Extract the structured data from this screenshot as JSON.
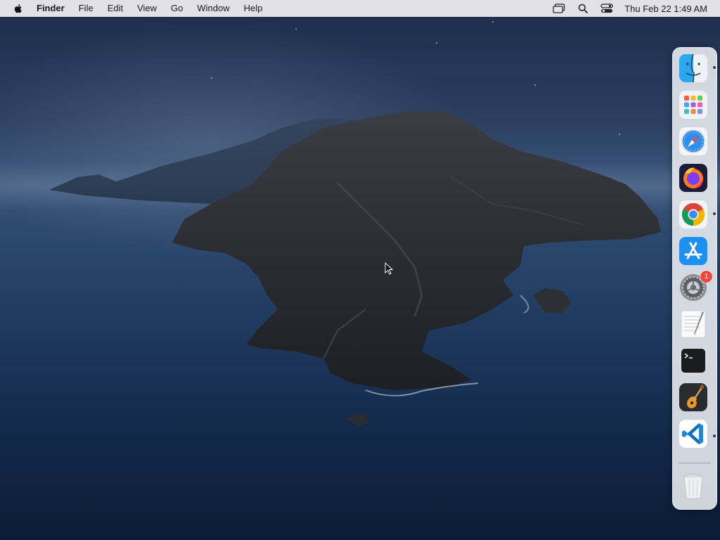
{
  "menubar": {
    "app_name": "Finder",
    "menus": [
      "File",
      "Edit",
      "View",
      "Go",
      "Window",
      "Help"
    ],
    "clock": "Thu Feb 22  1:49 AM",
    "status_icons": [
      "screen-mirroring-icon",
      "spotlight-search-icon",
      "control-center-icon"
    ]
  },
  "dock": {
    "items": [
      {
        "name": "Finder",
        "icon": "finder-icon",
        "running": true
      },
      {
        "name": "Launchpad",
        "icon": "launchpad-icon",
        "running": false
      },
      {
        "name": "Safari",
        "icon": "safari-icon",
        "running": false
      },
      {
        "name": "Firefox",
        "icon": "firefox-icon",
        "running": false
      },
      {
        "name": "Google Chrome",
        "icon": "chrome-icon",
        "running": true
      },
      {
        "name": "App Store",
        "icon": "app-store-icon",
        "running": false
      },
      {
        "name": "System Preferences",
        "icon": "system-preferences-icon",
        "running": false,
        "badge": "1"
      },
      {
        "name": "TextEdit",
        "icon": "textedit-icon",
        "running": false
      },
      {
        "name": "Terminal",
        "icon": "terminal-icon",
        "running": false
      },
      {
        "name": "GarageBand",
        "icon": "garageband-icon",
        "running": false
      },
      {
        "name": "Visual Studio Code",
        "icon": "vscode-icon",
        "running": true
      },
      {
        "name": "Trash",
        "icon": "trash-icon",
        "running": false
      }
    ]
  },
  "colors": {
    "menubar_bg": "#e8e8ec",
    "badge": "#f2473f",
    "desktop_sky": "#2b3e5f",
    "desktop_sea": "#13294a"
  }
}
